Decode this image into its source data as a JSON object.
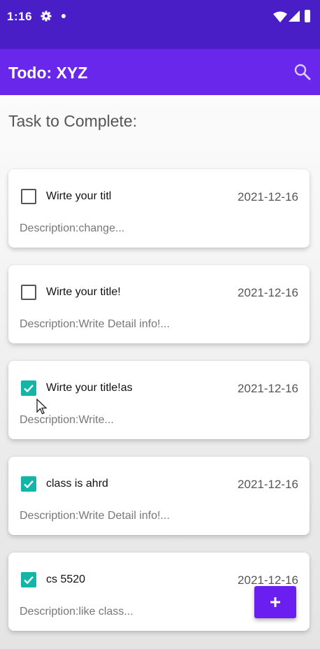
{
  "status_bar": {
    "time": "1:16",
    "icons": [
      "gear-icon",
      "dot-icon",
      "wifi-icon",
      "signal-icon",
      "battery-icon"
    ]
  },
  "app_bar": {
    "title": "Todo: XYZ",
    "action_icon": "search-icon"
  },
  "section_title": "Task to Complete:",
  "tasks": [
    {
      "checked": false,
      "title": "Wirte your titl",
      "date": "2021-12-16",
      "description": "Description:change..."
    },
    {
      "checked": false,
      "title": "Wirte your title!",
      "date": "2021-12-16",
      "description": "Description:Write Detail info!..."
    },
    {
      "checked": true,
      "title": "Wirte your title!as",
      "date": "2021-12-16",
      "description": "Description:Write..."
    },
    {
      "checked": true,
      "title": "class is ahrd",
      "date": "2021-12-16",
      "description": "Description:Write Detail info!..."
    },
    {
      "checked": true,
      "title": "cs 5520",
      "date": "2021-12-16",
      "description": "Description:like class..."
    }
  ],
  "fab": {
    "label": "+",
    "icon": "plus-icon"
  },
  "colors": {
    "status_bar": "#4a1ec7",
    "app_bar": "#6a27ec",
    "checkbox_checked": "#13b5a6",
    "fab": "#6a1ef0"
  }
}
